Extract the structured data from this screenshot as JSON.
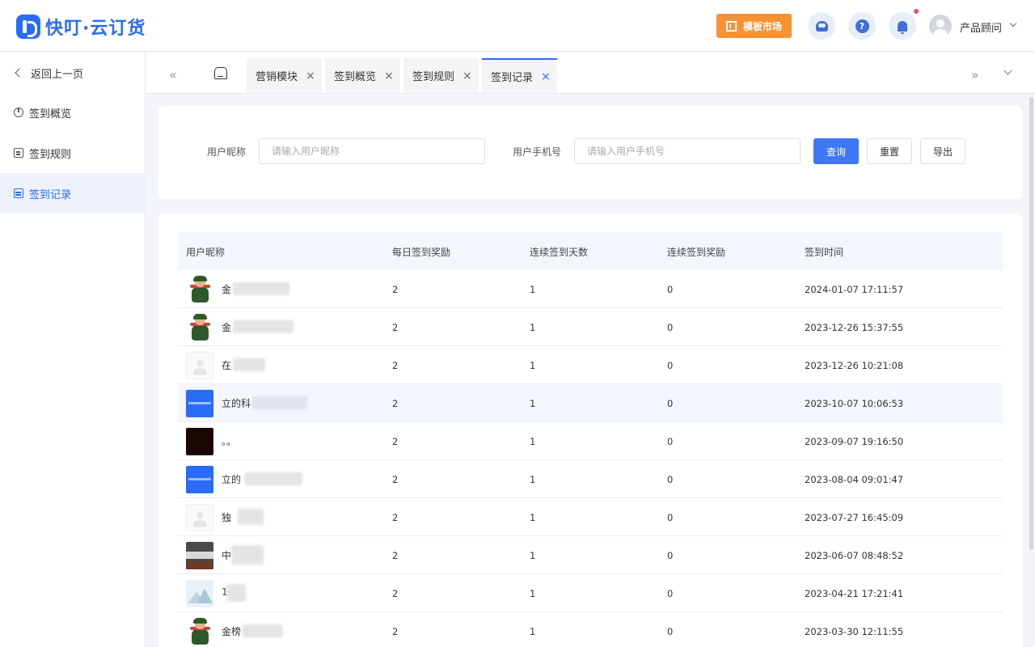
{
  "app": {
    "logo_text": "快叮·云订货",
    "brand_color": "#2a6cf6",
    "accent_color": "#f79233"
  },
  "header": {
    "market_button": "模板市场",
    "icons": [
      "customer-service-icon",
      "help-icon",
      "bell-icon"
    ],
    "has_notification_dot": true,
    "user_name": "产品顾问"
  },
  "sidebar": {
    "back": "返回上一页",
    "items": [
      {
        "label": "签到概览",
        "icon": "pie-chart-icon",
        "active": false
      },
      {
        "label": "签到规则",
        "icon": "document-icon",
        "active": false
      },
      {
        "label": "签到记录",
        "icon": "calendar-icon",
        "active": true
      }
    ]
  },
  "tabs": {
    "prev_icon": "«",
    "next_icon": "»",
    "items": [
      {
        "label": "营销模块",
        "close": "×"
      },
      {
        "label": "签到概览",
        "close": "×"
      },
      {
        "label": "签到规则",
        "close": "×"
      },
      {
        "label": "签到记录",
        "close": "×",
        "active": true
      }
    ]
  },
  "filter": {
    "nickname_label": "用户昵称",
    "nickname_placeholder": "请输入用户昵称",
    "nickname_value": "",
    "phone_label": "用户手机号",
    "phone_placeholder": "请输入用户手机号",
    "phone_value": "",
    "query_button": "查询",
    "reset_button": "重置",
    "export_button": "导出"
  },
  "table": {
    "columns": [
      "用户昵称",
      "每日签到奖励",
      "连续签到天数",
      "连续签到奖励",
      "签到时间"
    ],
    "rows": [
      {
        "avatar": "doll",
        "name": "金",
        "daily_reward": "2",
        "consecutive_days": "1",
        "consecutive_reward": "0",
        "time": "2024-01-07 17:11:57"
      },
      {
        "avatar": "doll",
        "name": "金",
        "daily_reward": "2",
        "consecutive_days": "1",
        "consecutive_reward": "0",
        "time": "2023-12-26 15:37:55"
      },
      {
        "avatar": "blank",
        "name": "在",
        "daily_reward": "2",
        "consecutive_days": "1",
        "consecutive_reward": "0",
        "time": "2023-12-26 10:21:08"
      },
      {
        "avatar": "blue",
        "name": "立的科",
        "daily_reward": "2",
        "consecutive_days": "1",
        "consecutive_reward": "0",
        "time": "2023-10-07 10:06:53",
        "highlighted": true
      },
      {
        "avatar": "dark",
        "name": "。。",
        "daily_reward": "2",
        "consecutive_days": "1",
        "consecutive_reward": "0",
        "time": "2023-09-07 19:16:50"
      },
      {
        "avatar": "blue",
        "name": "立的",
        "daily_reward": "2",
        "consecutive_days": "1",
        "consecutive_reward": "0",
        "time": "2023-08-04 09:01:47"
      },
      {
        "avatar": "blank",
        "name": "独",
        "daily_reward": "2",
        "consecutive_days": "1",
        "consecutive_reward": "0",
        "time": "2023-07-27 16:45:09"
      },
      {
        "avatar": "photo",
        "name": "中",
        "daily_reward": "2",
        "consecutive_days": "1",
        "consecutive_reward": "0",
        "time": "2023-06-07 08:48:52"
      },
      {
        "avatar": "sky",
        "name": "1",
        "daily_reward": "2",
        "consecutive_days": "1",
        "consecutive_reward": "0",
        "time": "2023-04-21 17:21:41"
      },
      {
        "avatar": "doll",
        "name": "金榜",
        "daily_reward": "2",
        "consecutive_days": "1",
        "consecutive_reward": "0",
        "time": "2023-03-30 12:11:55"
      }
    ]
  }
}
